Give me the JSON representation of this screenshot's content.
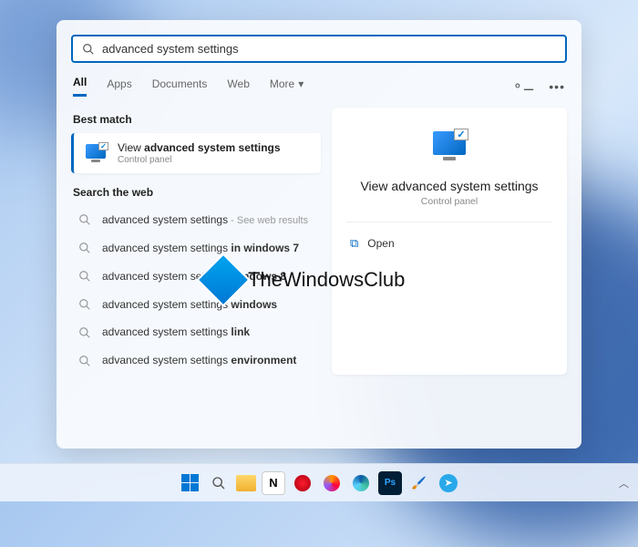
{
  "search": {
    "query": "advanced system settings"
  },
  "tabs": {
    "all": "All",
    "apps": "Apps",
    "documents": "Documents",
    "web": "Web",
    "more": "More"
  },
  "sections": {
    "best_match": "Best match",
    "search_web": "Search the web"
  },
  "best_match": {
    "prefix": "View ",
    "bold": "advanced system settings",
    "sub": "Control panel"
  },
  "web_results": [
    {
      "plain": "advanced system settings",
      "bold": "",
      "suffix": " - See web results"
    },
    {
      "plain": "advanced system settings ",
      "bold": "in windows 7",
      "suffix": ""
    },
    {
      "plain": "advanced system settings ",
      "bold": "windows 8",
      "suffix": ""
    },
    {
      "plain": "advanced system settings ",
      "bold": "windows",
      "suffix": ""
    },
    {
      "plain": "advanced system settings ",
      "bold": "link",
      "suffix": ""
    },
    {
      "plain": "advanced system settings ",
      "bold": "environment",
      "suffix": ""
    }
  ],
  "preview": {
    "title": "View advanced system settings",
    "sub": "Control panel",
    "open": "Open"
  },
  "watermark": "TheWindowsClub",
  "taskbar": {
    "icons": [
      "start",
      "search",
      "explorer",
      "notion",
      "opera",
      "firefox",
      "edge",
      "photoshop",
      "paint",
      "telegram"
    ]
  }
}
